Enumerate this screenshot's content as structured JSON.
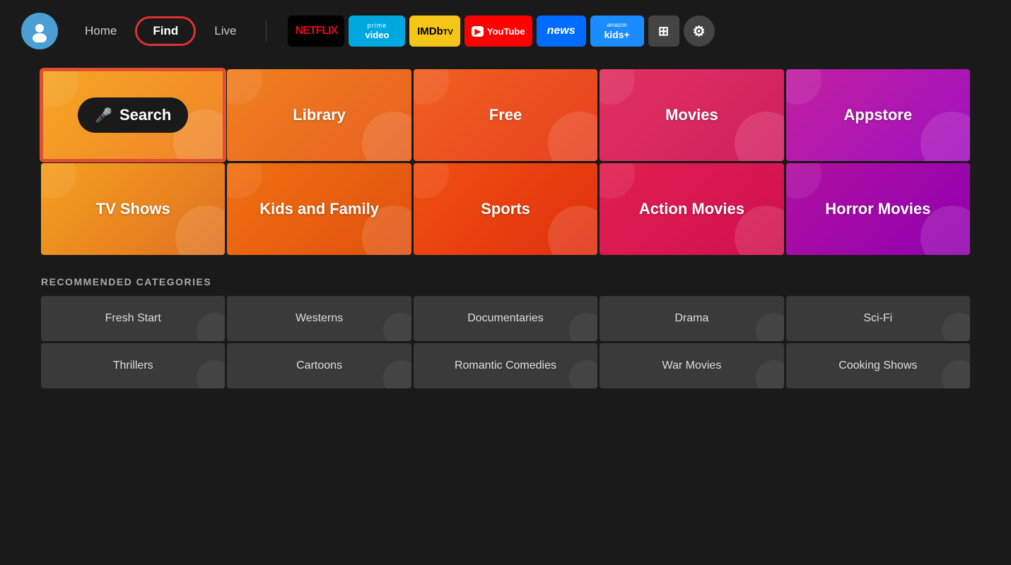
{
  "header": {
    "nav": {
      "home_label": "Home",
      "find_label": "Find",
      "live_label": "Live"
    },
    "services": [
      {
        "id": "netflix",
        "label": "NETFLIX",
        "type": "netflix"
      },
      {
        "id": "prime",
        "label": "prime video",
        "type": "prime"
      },
      {
        "id": "imdb",
        "label": "IMDb TV",
        "type": "imdb"
      },
      {
        "id": "youtube",
        "label": "YouTube",
        "type": "youtube"
      },
      {
        "id": "news",
        "label": "news",
        "type": "news"
      },
      {
        "id": "amazon-kids",
        "label": "amazon kids+",
        "type": "amazon-kids"
      }
    ],
    "icon_apps": "⊞",
    "icon_settings": "⚙"
  },
  "main_grid": {
    "cells": [
      {
        "id": "search",
        "label": "Search",
        "type": "search"
      },
      {
        "id": "library",
        "label": "Library",
        "type": "library"
      },
      {
        "id": "free",
        "label": "Free",
        "type": "free"
      },
      {
        "id": "movies",
        "label": "Movies",
        "type": "movies"
      },
      {
        "id": "appstore",
        "label": "Appstore",
        "type": "appstore"
      },
      {
        "id": "tvshows",
        "label": "TV Shows",
        "type": "tvshows"
      },
      {
        "id": "kidsandfamily",
        "label": "Kids and Family",
        "type": "kidsandfamily"
      },
      {
        "id": "sports",
        "label": "Sports",
        "type": "sports"
      },
      {
        "id": "actionmovies",
        "label": "Action Movies",
        "type": "actionmovies"
      },
      {
        "id": "horrormovies",
        "label": "Horror Movies",
        "type": "horrormovies"
      }
    ]
  },
  "recommended": {
    "title": "RECOMMENDED CATEGORIES",
    "categories": [
      {
        "id": "fresh-start",
        "label": "Fresh Start"
      },
      {
        "id": "westerns",
        "label": "Westerns"
      },
      {
        "id": "documentaries",
        "label": "Documentaries"
      },
      {
        "id": "drama",
        "label": "Drama"
      },
      {
        "id": "sci-fi",
        "label": "Sci-Fi"
      },
      {
        "id": "thrillers",
        "label": "Thrillers"
      },
      {
        "id": "cartoons",
        "label": "Cartoons"
      },
      {
        "id": "romantic-comedies",
        "label": "Romantic Comedies"
      },
      {
        "id": "war-movies",
        "label": "War Movies"
      },
      {
        "id": "cooking-shows",
        "label": "Cooking Shows"
      }
    ]
  }
}
